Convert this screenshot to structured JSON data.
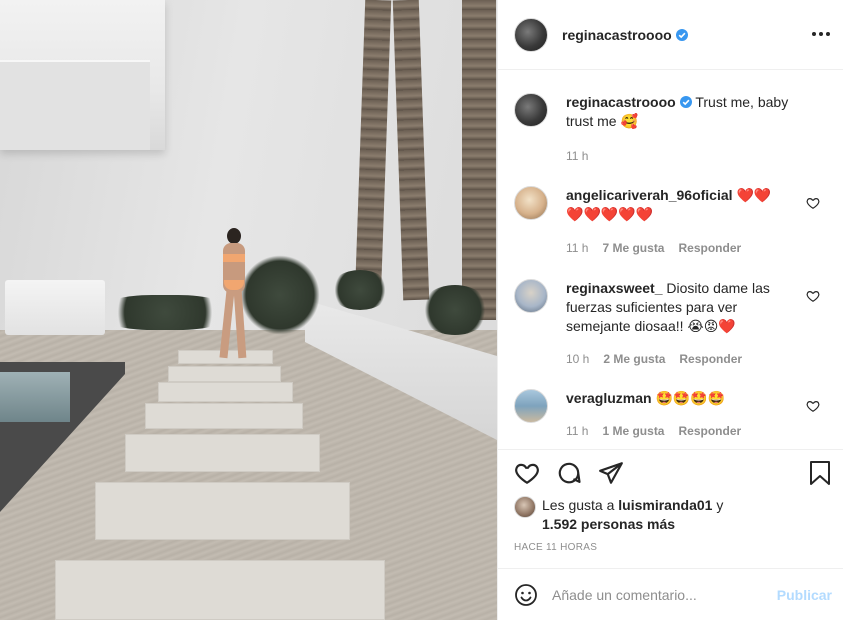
{
  "post": {
    "author": {
      "username": "reginacastroooo",
      "verified": true
    },
    "caption": {
      "text": "Trust me, baby",
      "text2": "trust me",
      "emoji": "🥰",
      "time": "11 h"
    },
    "comments": [
      {
        "username": "angelicariverah_96oficial",
        "text": "",
        "emojis": [
          "❤️",
          "❤️",
          "❤️",
          "❤️",
          "❤️",
          "❤️",
          "❤️"
        ],
        "time": "11 h",
        "likes": "7 Me gusta",
        "reply": "Responder"
      },
      {
        "username": "reginaxsweet_",
        "text": "Diosito dame las fuerzas suficientes para ver semejante diosaa!!",
        "emojis": [
          "😭",
          "😡",
          "❤️"
        ],
        "time": "10 h",
        "likes": "2 Me gusta",
        "reply": "Responder"
      },
      {
        "username": "veragluzman",
        "text": "",
        "emojis": [
          "🤩",
          "🤩",
          "🤩",
          "🤩"
        ],
        "time": "11 h",
        "likes": "1 Me gusta",
        "reply": "Responder"
      }
    ],
    "likes": {
      "prefix": "Les gusta a",
      "user": "luismiranda01",
      "connector": "y",
      "others": "1.592 personas más"
    },
    "timestamp": "HACE 11 HORAS",
    "add_comment": {
      "placeholder": "Añade un comentario...",
      "publish_label": "Publicar"
    }
  },
  "icons": {
    "like": "heart-icon",
    "comment": "comment-icon",
    "share": "share-icon",
    "save": "bookmark-icon",
    "emoji": "smiley-icon",
    "more": "more-options-icon",
    "verified": "verified-badge-icon"
  },
  "colors": {
    "verified": "#3897f0",
    "publish_disabled": "#b3dbff",
    "text": "#262626",
    "muted": "#8e8e8e",
    "heart_red": "#ed4956"
  }
}
